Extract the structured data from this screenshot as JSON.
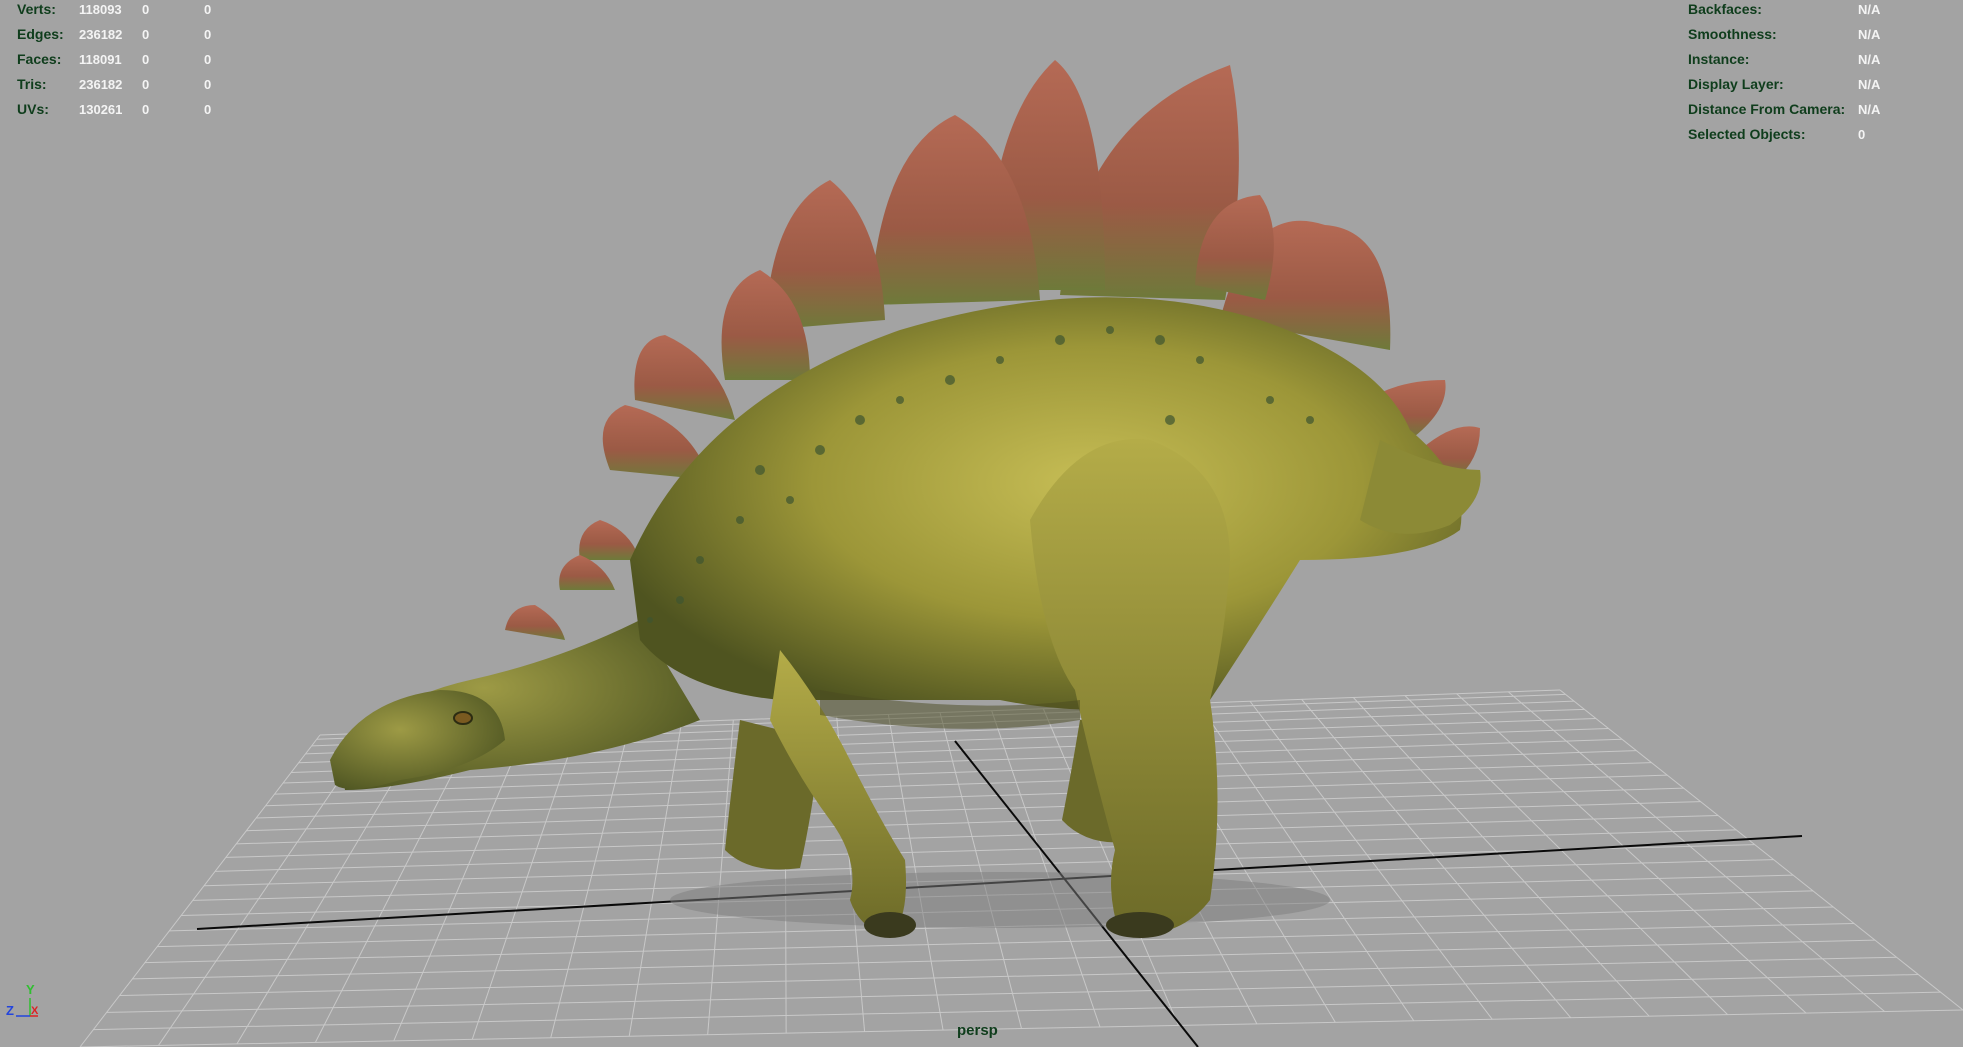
{
  "hud": {
    "poly_stats": [
      {
        "label": "Verts:",
        "value": "118093",
        "selected": "0",
        "component": "0"
      },
      {
        "label": "Edges:",
        "value": "236182",
        "selected": "0",
        "component": "0"
      },
      {
        "label": "Faces:",
        "value": "118091",
        "selected": "0",
        "component": "0"
      },
      {
        "label": "Tris:",
        "value": "236182",
        "selected": "0",
        "component": "0"
      },
      {
        "label": "UVs:",
        "value": "130261",
        "selected": "0",
        "component": "0"
      }
    ],
    "object_details": [
      {
        "label": "Backfaces:",
        "value": "N/A"
      },
      {
        "label": "Smoothness:",
        "value": "N/A"
      },
      {
        "label": "Instance:",
        "value": "N/A"
      },
      {
        "label": "Display Layer:",
        "value": "N/A"
      },
      {
        "label": "Distance From Camera:",
        "value": "N/A"
      },
      {
        "label": "Selected Objects:",
        "value": "0"
      }
    ]
  },
  "viewport": {
    "camera_name": "persp",
    "background_color": "#a3a3a3",
    "grid_color": "#c8c8c8",
    "axis_line_color": "#0a0a0a"
  },
  "axis_gizmo": {
    "y_label": "Y",
    "z_label": "Z",
    "x_label": "X",
    "y_color": "#2fbf2f",
    "z_color": "#2244dd",
    "x_color": "#dd2222"
  },
  "scene": {
    "model_icon": "stegosaurus-model",
    "body_color": "#9a9a3a",
    "plate_color": "#a55a44"
  }
}
